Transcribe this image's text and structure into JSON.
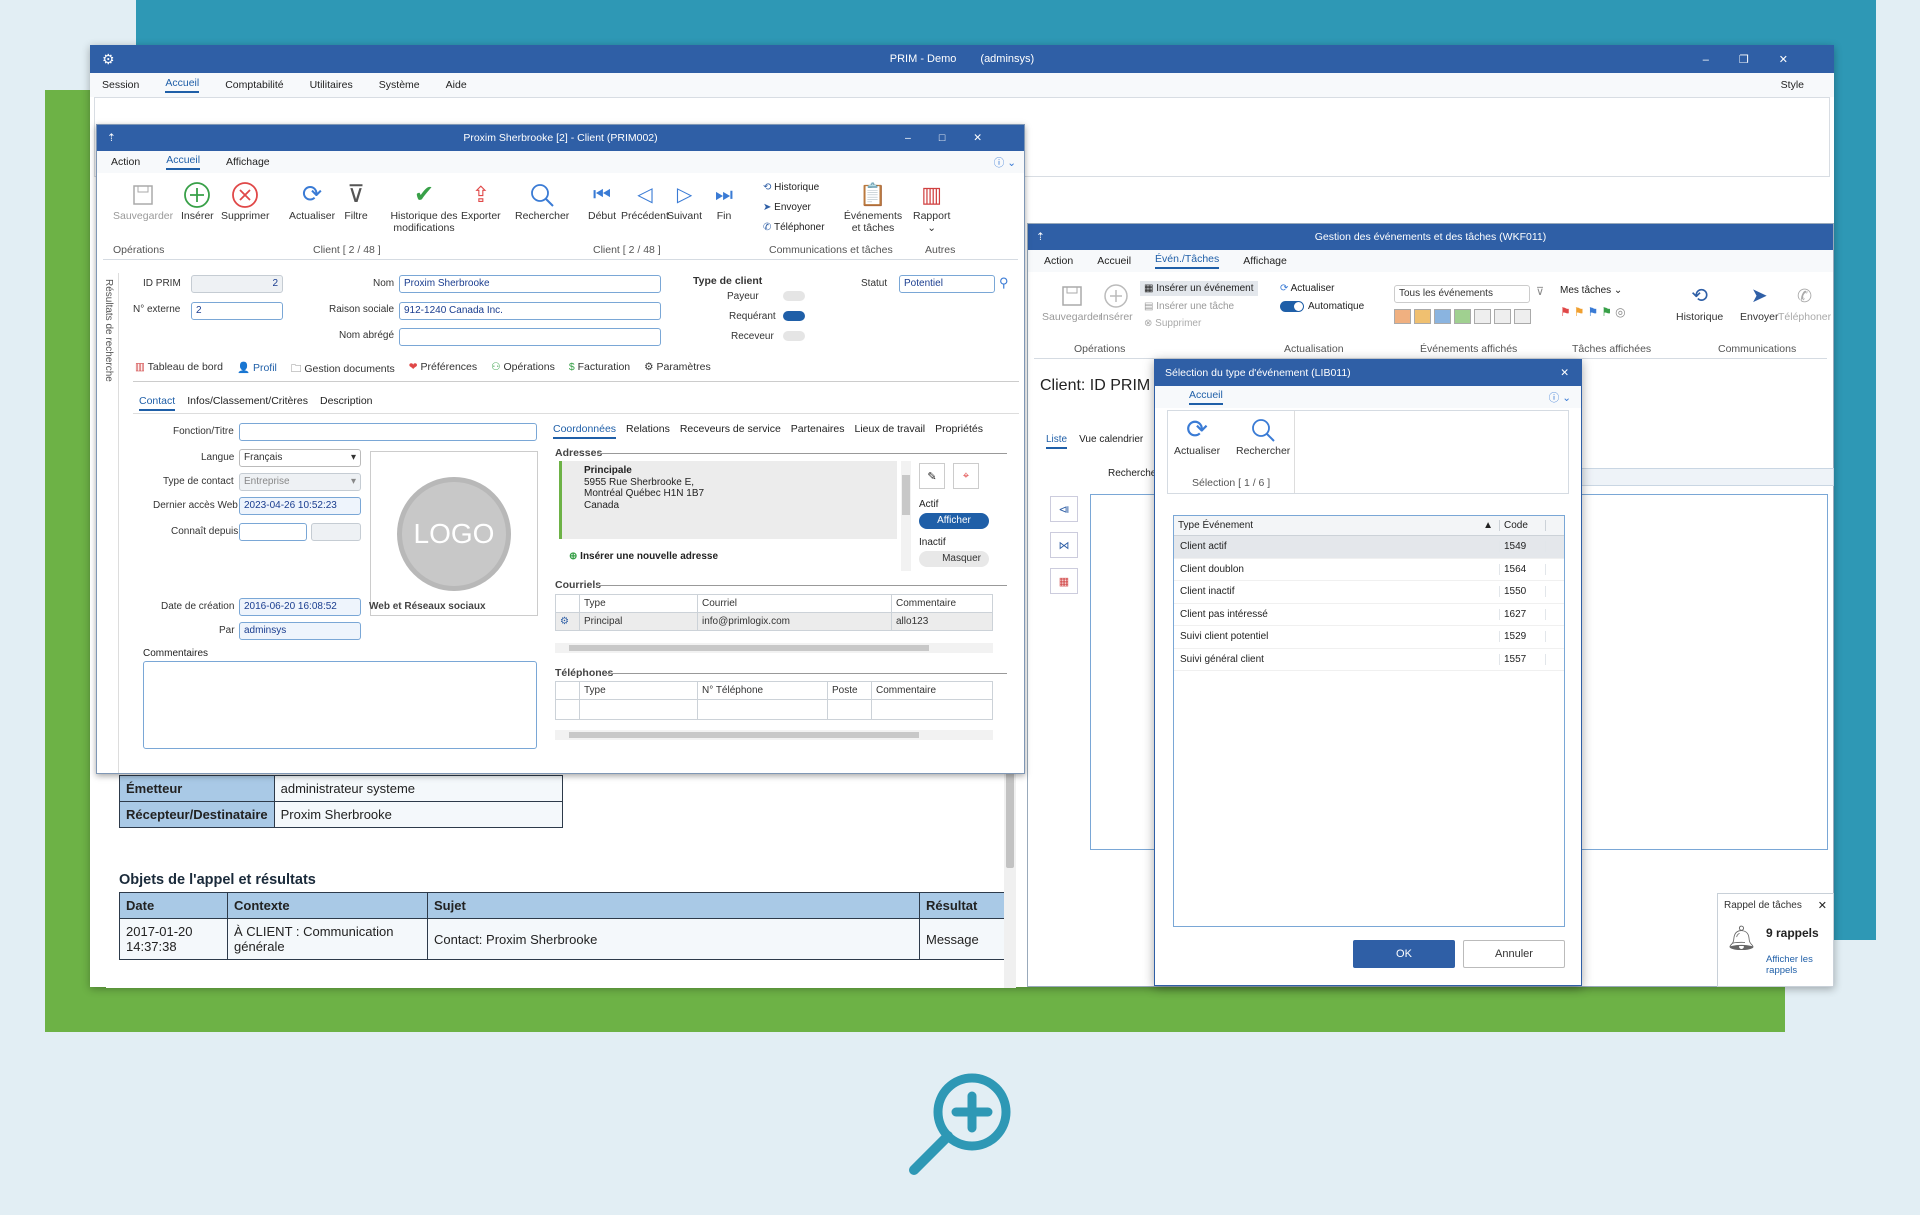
{
  "main": {
    "title": "PRIM - Demo",
    "user": "(adminsys)",
    "menu": [
      "Session",
      "Accueil",
      "Comptabilité",
      "Utilitaires",
      "Système",
      "Aide"
    ],
    "style_label": "Style"
  },
  "client": {
    "title": "Proxim Sherbrooke [2] - Client (PRIM002)",
    "tabs": [
      "Action",
      "Accueil",
      "Affichage"
    ],
    "ribbon": {
      "save": "Sauvegarder",
      "insert": "Insérer",
      "delete": "Supprimer",
      "refresh": "Actualiser",
      "filter": "Filtre",
      "history_mod": "Historique des modifications",
      "export": "Exporter",
      "search": "Rechercher",
      "first": "Début",
      "prev": "Précédent",
      "next": "Suivant",
      "last": "Fin",
      "historique": "Historique",
      "envoyer": "Envoyer",
      "telephoner": "Téléphoner",
      "events": "Événements et tâches",
      "report": "Rapport",
      "g_ops": "Opérations",
      "g_client1": "Client [ 2 / 48 ]",
      "g_client2": "Client [ 2 / 48 ]",
      "g_comm": "Communications et tâches",
      "g_other": "Autres"
    },
    "side_label": "Résultats de recherche",
    "id_label": "ID PRIM",
    "id_value": "2",
    "ext_label": "N° externe",
    "ext_value": "2",
    "nom_label": "Nom",
    "nom_value": "Proxim Sherbrooke",
    "raison_label": "Raison sociale",
    "raison_value": "912-1240 Canada Inc.",
    "abrege_label": "Nom abrégé",
    "type_client": "Type de client",
    "payeur": "Payeur",
    "requerant": "Requérant",
    "receveur": "Receveur",
    "statut_label": "Statut",
    "statut_value": "Potentiel",
    "subnav": [
      "Tableau de bord",
      "Profil",
      "Gestion documents",
      "Préférences",
      "Opérations",
      "Facturation",
      "Paramètres"
    ],
    "subtabs": [
      "Contact",
      "Infos/Classement/Critères",
      "Description"
    ],
    "fonction": "Fonction/Titre",
    "langue": "Langue",
    "langue_value": "Français",
    "type_contact": "Type de contact",
    "type_contact_value": "Entreprise",
    "dernier": "Dernier accès Web",
    "dernier_value": "2023-04-26 10:52:23",
    "connait": "Connaît depuis",
    "logo": "LOGO",
    "creation": "Date de création",
    "creation_value": "2016-06-20 16:08:52",
    "par": "Par",
    "par_value": "adminsys",
    "web": "Web et Réseaux sociaux",
    "commentaires": "Commentaires",
    "coord_tabs": [
      "Coordonnées",
      "Relations",
      "Receveurs de service",
      "Partenaires",
      "Lieux de travail",
      "Propriétés"
    ],
    "adresses": "Adresses",
    "addr_title": "Principale",
    "addr_l1": "5955 Rue Sherbrooke E,",
    "addr_l2": "Montréal Québec H1N 1B7",
    "addr_l3": "Canada",
    "actif": "Actif",
    "afficher": "Afficher",
    "inactif": "Inactif",
    "masquer": "Masquer",
    "insert_addr": "Insérer une nouvelle adresse",
    "courriels": "Courriels",
    "cour_cols": [
      "Type",
      "Courriel",
      "Commentaire"
    ],
    "cour_row": [
      "Principal",
      "info@primlogix.com",
      "allo123"
    ],
    "telephones": "Téléphones",
    "tel_cols": [
      "Type",
      "N° Téléphone",
      "Poste",
      "Commentaire"
    ]
  },
  "report": {
    "emetteur_label": "Émetteur",
    "emetteur": "administrateur systeme",
    "recept_label": "Récepteur/Destinataire",
    "recept": "Proxim Sherbrooke",
    "section": "Objets de l'appel et résultats",
    "cols": [
      "Date",
      "Contexte",
      "Sujet",
      "Résultat"
    ],
    "row": [
      "2017-01-20 14:37:38",
      "À CLIENT : Communication générale",
      "Contact: Proxim Sherbrooke",
      "Message"
    ]
  },
  "events": {
    "title": "Gestion des événements et des tâches (WKF011)",
    "tabs": [
      "Action",
      "Accueil",
      "Évén./Tâches",
      "Affichage"
    ],
    "save": "Sauvegarder",
    "insert": "Insérer",
    "ins_event": "Insérer un événement",
    "ins_task": "Insérer une tâche",
    "delete": "Supprimer",
    "refresh": "Actualiser",
    "auto": "Automatique",
    "filter": "Tous les événements",
    "mes_taches": "Mes tâches",
    "historique": "Historique",
    "envoyer": "Envoyer",
    "telephoner": "Téléphoner",
    "g_ops": "Opérations",
    "g_act": "Actualisation",
    "g_ev": "Événements affichés",
    "g_tasks": "Tâches affichées",
    "g_comm": "Communications",
    "client_label": "Client: ID PRIM 2",
    "list_tab": "Liste",
    "cal_tab": "Vue calendrier",
    "search": "Recherche"
  },
  "dialog": {
    "title": "Sélection du type d'événement (LIB011)",
    "tab": "Accueil",
    "refresh": "Actualiser",
    "search": "Rechercher",
    "group": "Sélection [ 1 / 6 ]",
    "col_type": "Type Événement",
    "col_code": "Code",
    "rows": [
      {
        "type": "Client actif",
        "code": "1549"
      },
      {
        "type": "Client doublon",
        "code": "1564"
      },
      {
        "type": "Client inactif",
        "code": "1550"
      },
      {
        "type": "Client pas intéressé",
        "code": "1627"
      },
      {
        "type": "Suivi client potentiel",
        "code": "1529"
      },
      {
        "type": "Suivi général client",
        "code": "1557"
      }
    ],
    "ok": "OK",
    "cancel": "Annuler"
  },
  "reminder": {
    "title": "Rappel de tâches",
    "count": "9 rappels",
    "link": "Afficher les rappels"
  },
  "colors": {
    "teal": "#2e98b5",
    "green": "#6db246",
    "title_blue": "#2f5fa6",
    "bg": "#e2eef4"
  }
}
